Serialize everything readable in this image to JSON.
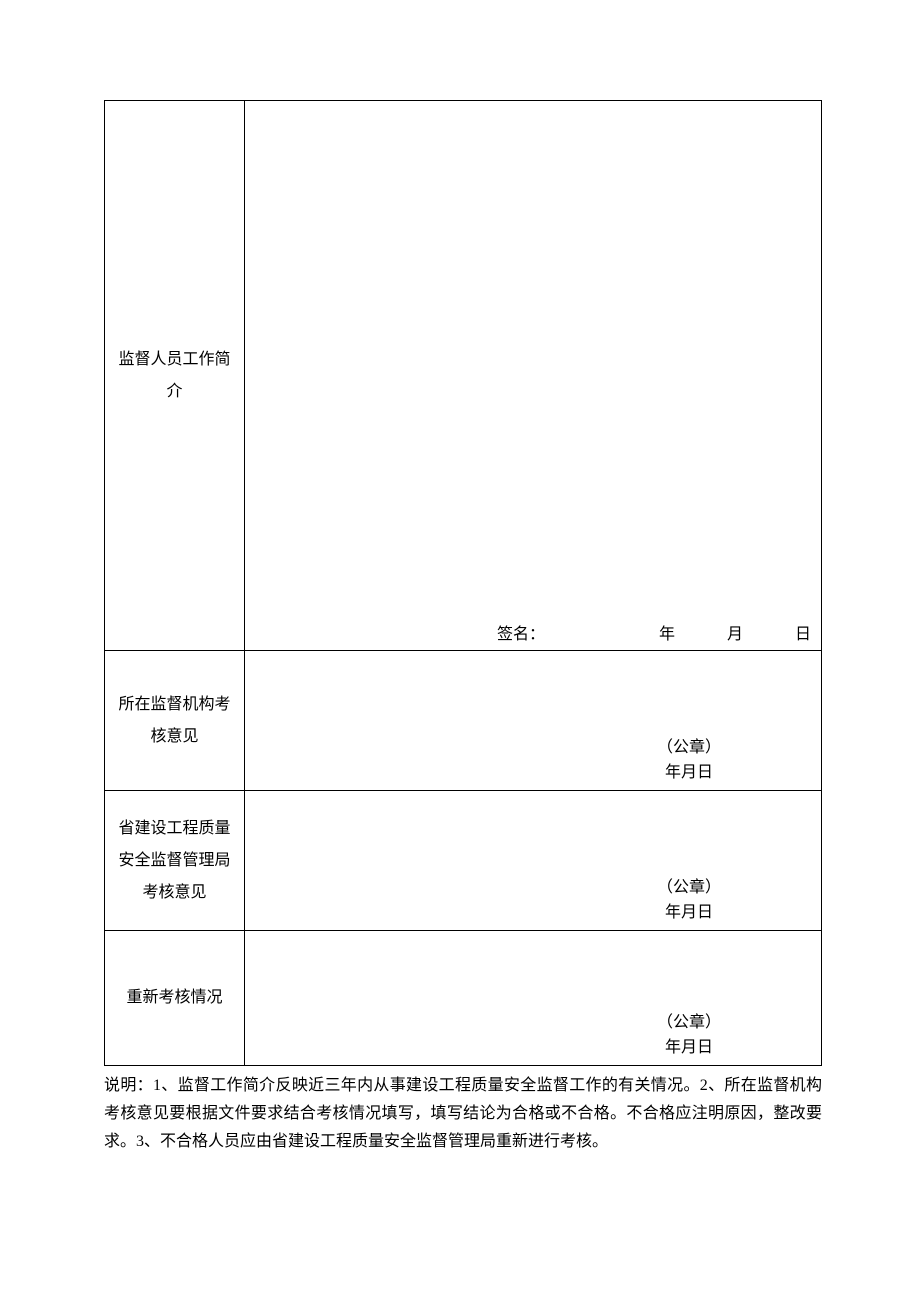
{
  "rows": {
    "work_brief": {
      "label": "监督人员工作简介",
      "signature_label": "签名：",
      "year_char": "年",
      "month_char": "月",
      "day_char": "日"
    },
    "org_opinion": {
      "label": "所在监督机构考核意见",
      "seal": "（公章）",
      "date": "年月日"
    },
    "province_opinion": {
      "label": "省建设工程质量安全监督管理局考核意见",
      "seal": "（公章）",
      "date": "年月日"
    },
    "reassessment": {
      "label": "重新考核情况",
      "seal": "（公章）",
      "date": "年月日"
    }
  },
  "footnote": "说明：1、监督工作简介反映近三年内从事建设工程质量安全监督工作的有关情况。2、所在监督机构考核意见要根据文件要求结合考核情况填写，填写结论为合格或不合格。不合格应注明原因，整改要求。3、不合格人员应由省建设工程质量安全监督管理局重新进行考核。"
}
